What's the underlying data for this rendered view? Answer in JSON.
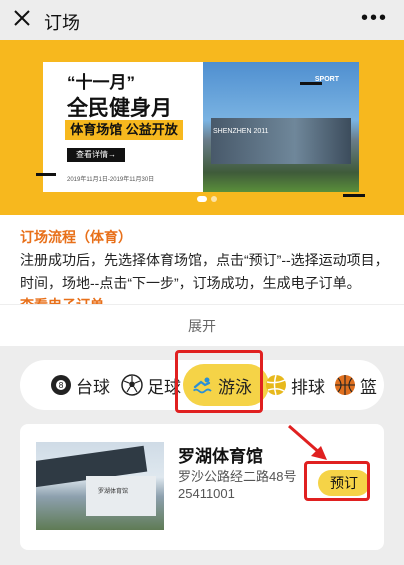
{
  "header": {
    "title": "订场",
    "more": "•••"
  },
  "banner": {
    "quote": "“十一月”",
    "headline": "全民健身月",
    "tagline": "体育场馆 公益开放",
    "detail_button": "查看详情→",
    "date": "2019年11月1日-2019年11月30日",
    "sport_label": "SPORT",
    "building_text": "SHENZHEN 2011"
  },
  "flow": {
    "heading": "订场流程（体育）",
    "body": "注册成功后，先选择体育场馆，点击“预订”--选择运动项目，时间，场地--点击“下一步”，订场成功，生成电子订单。",
    "next_heading_partial": "查看电子订单"
  },
  "expand_label": "展开",
  "categories": [
    {
      "label": "台球",
      "icon": "billiards-icon",
      "color": "#222222"
    },
    {
      "label": "足球",
      "icon": "soccer-icon",
      "color": "#222222"
    },
    {
      "label": "游泳",
      "icon": "swimming-icon",
      "color": "#2a8fd6",
      "active": true
    },
    {
      "label": "排球",
      "icon": "volleyball-icon",
      "color": "#e7b81c"
    },
    {
      "label": "篮",
      "icon": "basketball-icon",
      "color": "#e0701f"
    }
  ],
  "venue": {
    "name": "罗湖体育馆",
    "address": "罗沙公路经二路48号",
    "phone": "25411001",
    "book_label": "预订",
    "image_caption": "罗湖体育馆"
  },
  "colors": {
    "accent": "#f5d347",
    "highlight": "#e02020",
    "orange_text": "#e8701a"
  }
}
